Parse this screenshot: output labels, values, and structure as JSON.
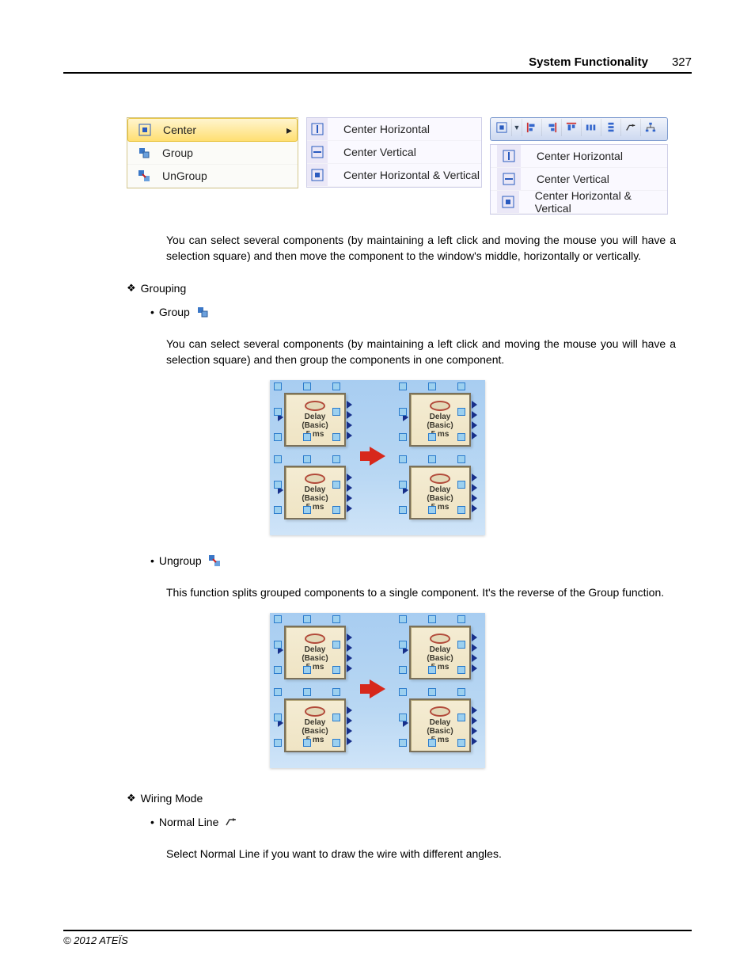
{
  "header": {
    "title": "System Functionality",
    "page": "327"
  },
  "menus": {
    "menu1": {
      "items": [
        {
          "label": "Center",
          "icon": "center-both-icon",
          "highlighted": true,
          "hasSubmenu": true
        },
        {
          "label": "Group",
          "icon": "group-icon"
        },
        {
          "label": "UnGroup",
          "icon": "ungroup-icon"
        }
      ]
    },
    "menu2": {
      "items": [
        {
          "label": "Center Horizontal",
          "icon": "center-h-icon"
        },
        {
          "label": "Center Vertical",
          "icon": "center-v-icon"
        },
        {
          "label": "Center Horizontal & Vertical",
          "icon": "center-both-icon"
        }
      ]
    },
    "toolbar": {
      "buttons": [
        "center-both-icon",
        "dropdown-icon",
        "align-left-icon",
        "align-right-icon",
        "align-top-icon",
        "distribute-h-icon",
        "distribute-v-icon",
        "wiring-icon",
        "tree-icon"
      ]
    },
    "menu3": {
      "items": [
        {
          "label": "Center Horizontal",
          "icon": "center-h-icon"
        },
        {
          "label": "Center Vertical",
          "icon": "center-v-icon"
        },
        {
          "label": "Center Horizontal & Vertical",
          "icon": "center-both-icon"
        }
      ]
    }
  },
  "paragraphs": {
    "center_desc": "You can select several components (by maintaining a left click and moving the mouse you will have a selection square) and then move the component to the window's middle, horizontally or vertically.",
    "grouping_hdr": "Grouping",
    "group_label": "Group",
    "group_desc": "You can select several components (by maintaining a left click and moving the mouse you will have a selection square) and then group the components in one component.",
    "ungroup_label": "Ungroup",
    "ungroup_desc": "This function splits grouped components to a single component. It's the reverse of the Group function.",
    "wiring_hdr": "Wiring Mode",
    "normal_line_label": "Normal Line",
    "normal_line_desc": "Select Normal Line if you want to draw the wire with different angles."
  },
  "node": {
    "line1": "Delay",
    "line2": "(Basic)",
    "line3": "5 ms"
  },
  "footer": {
    "copyright": "© 2012 ATEÏS"
  }
}
